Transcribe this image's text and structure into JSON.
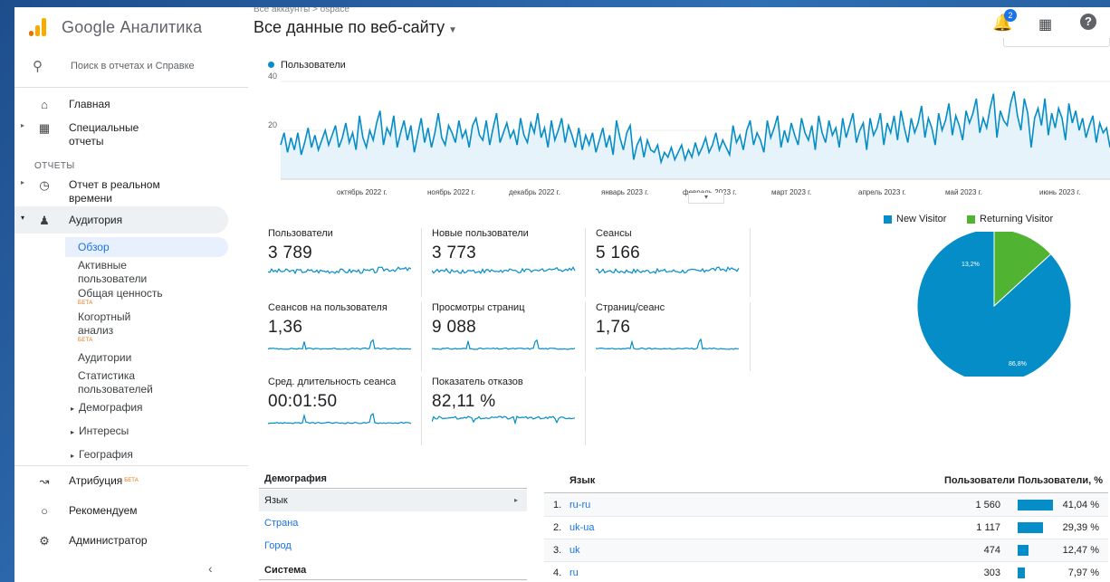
{
  "app": {
    "title": "Google Аналитика"
  },
  "header": {
    "breadcrumb": "Все аккаунты > ospace",
    "view": "Все данные по веб-сайту",
    "notifications_count": "2",
    "help_icon": "?"
  },
  "sidebar": {
    "search_placeholder": "Поиск в отчетах и Справке",
    "home": "Главная",
    "custom_reports": "Специальные отчеты",
    "reports_section": "ОТЧЕТЫ",
    "realtime": "Отчет в реальном времени",
    "audience": "Аудитория",
    "audience_items": {
      "overview": "Обзор",
      "active_users": "Активные пользователи",
      "lifetime_value": "Общая ценность",
      "cohort": "Когортный анализ",
      "audiences": "Аудитории",
      "user_explorer": "Статистика пользователей",
      "demographics": "Демография",
      "interests": "Интересы",
      "geo": "География"
    },
    "beta_label": "БЕТА",
    "attribution": "Атрибуция",
    "recommended": "Рекомендуем",
    "admin": "Администратор"
  },
  "colors": {
    "series": "#058dc7",
    "new_visitor": "#058dc7",
    "returning_visitor": "#50b432",
    "accent": "#1a73e8"
  },
  "chart_data": {
    "type": "line",
    "title": "",
    "legend": [
      "Пользователи"
    ],
    "ylim": [
      0,
      40
    ],
    "y_ticks": [
      "20",
      "40"
    ],
    "x_tick_labels": [
      "октябрь 2022 г.",
      "ноябрь 2022 г.",
      "декабрь 2022 г.",
      "январь 2023 г.",
      "февраль 2023 г.",
      "март 2023 г.",
      "апрель 2023 г.",
      "май 2023 г.",
      "июнь 2023 г."
    ],
    "series": [
      {
        "name": "Пользователи",
        "values": [
          14,
          19,
          11,
          17,
          12,
          19,
          10,
          15,
          21,
          13,
          18,
          12,
          16,
          20,
          14,
          18,
          22,
          13,
          17,
          23,
          15,
          19,
          12,
          26,
          17,
          13,
          20,
          16,
          23,
          28,
          14,
          21,
          18,
          26,
          13,
          19,
          24,
          16,
          22,
          11,
          18,
          25,
          15,
          21,
          13,
          19,
          27,
          17,
          14,
          22,
          19,
          15,
          24,
          17,
          20,
          13,
          22,
          25,
          18,
          16,
          24,
          14,
          21,
          27,
          15,
          19,
          23,
          17,
          20,
          14,
          25,
          18,
          15,
          23,
          19,
          27,
          17,
          21,
          13,
          24,
          16,
          20,
          25,
          15,
          22,
          18,
          13,
          21,
          12,
          18,
          14,
          19,
          11,
          16,
          21,
          13,
          18,
          10,
          24,
          17,
          12,
          19,
          22,
          8,
          14,
          17,
          9,
          16,
          12,
          11,
          14,
          7,
          11,
          9,
          13,
          8,
          11,
          14,
          8,
          12,
          9,
          15,
          10,
          13,
          17,
          11,
          14,
          19,
          12,
          16,
          13,
          10,
          22,
          15,
          18,
          12,
          20,
          24,
          14,
          19,
          16,
          11,
          24,
          17,
          21,
          26,
          13,
          20,
          15,
          23,
          18,
          14,
          25,
          19,
          16,
          22,
          12,
          26,
          19,
          15,
          24,
          18,
          21,
          13,
          25,
          17,
          22,
          27,
          15,
          20,
          23,
          12,
          25,
          18,
          21,
          27,
          14,
          23,
          19,
          26,
          16,
          28,
          21,
          15,
          25,
          19,
          23,
          30,
          17,
          25,
          21,
          14,
          27,
          20,
          24,
          31,
          18,
          26,
          22,
          16,
          28,
          23,
          27,
          33,
          19,
          25,
          21,
          29,
          35,
          17,
          28,
          24,
          22,
          31,
          36,
          26,
          20,
          33,
          27,
          13,
          25,
          29,
          22,
          33,
          18,
          27,
          21,
          29,
          25,
          16,
          31,
          23,
          28,
          20,
          25,
          17,
          22,
          26,
          15,
          23,
          19,
          21,
          13
        ]
      }
    ]
  },
  "scorecards": [
    {
      "label": "Пользователи",
      "value": "3 789"
    },
    {
      "label": "Новые пользователи",
      "value": "3 773"
    },
    {
      "label": "Сеансы",
      "value": "5 166"
    },
    {
      "label": "Сеансов на пользователя",
      "value": "1,36"
    },
    {
      "label": "Просмотры страниц",
      "value": "9 088"
    },
    {
      "label": "Страниц/сеанс",
      "value": "1,76"
    },
    {
      "label": "Сред. длительность сеанса",
      "value": "00:01:50"
    },
    {
      "label": "Показатель отказов",
      "value": "82,11 %"
    }
  ],
  "pie": {
    "legend": [
      {
        "name": "New Visitor",
        "value": 86.8
      },
      {
        "name": "Returning Visitor",
        "value": 13.2
      }
    ],
    "labels": {
      "new": "86,8%",
      "returning": "13,2%"
    }
  },
  "demographics": {
    "header": "Демография",
    "items": [
      "Язык",
      "Страна",
      "Город"
    ],
    "system_header": "Система"
  },
  "language_table": {
    "headers": {
      "language": "Язык",
      "users": "Пользователи",
      "users_pct": "Пользователи, %"
    },
    "rows": [
      {
        "num": "1.",
        "language": "ru-ru",
        "users": "1 560",
        "pct": "41,04 %",
        "share": 0.4104
      },
      {
        "num": "2.",
        "language": "uk-ua",
        "users": "1 117",
        "pct": "29,39 %",
        "share": 0.2939
      },
      {
        "num": "3.",
        "language": "uk",
        "users": "474",
        "pct": "12,47 %",
        "share": 0.1247
      },
      {
        "num": "4.",
        "language": "ru",
        "users": "303",
        "pct": "7,97 %",
        "share": 0.0797
      }
    ]
  }
}
